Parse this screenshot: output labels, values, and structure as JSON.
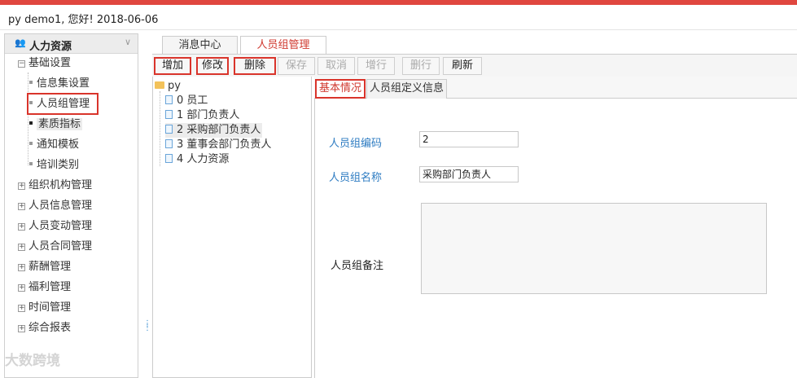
{
  "header": {
    "greeting": "py demo1, 您好! 2018-06-06"
  },
  "leftnav": {
    "title": "人力资源",
    "items": [
      {
        "label": "基础设置",
        "expanded": true
      },
      {
        "label": "信息集设置"
      },
      {
        "label": "人员组管理"
      },
      {
        "label": "素质指标"
      },
      {
        "label": "通知模板"
      },
      {
        "label": "培训类别"
      },
      {
        "label": "组织机构管理"
      },
      {
        "label": "人员信息管理"
      },
      {
        "label": "人员变动管理"
      },
      {
        "label": "人员合同管理"
      },
      {
        "label": "薪酬管理"
      },
      {
        "label": "福利管理"
      },
      {
        "label": "时间管理"
      },
      {
        "label": "综合报表"
      }
    ]
  },
  "tabs": [
    {
      "label": "消息中心"
    },
    {
      "label": "人员组管理"
    }
  ],
  "toolbar": {
    "add": "增加",
    "edit": "修改",
    "delete": "删除",
    "save": "保存",
    "cancel": "取消",
    "add_row": "增行",
    "delete_row": "删行",
    "refresh": "刷新"
  },
  "tree": {
    "root": "py",
    "children": [
      "0 员工",
      "1 部门负责人",
      "2 采购部门负责人",
      "3 董事会部门负责人",
      "4 人力资源"
    ]
  },
  "subtabs": [
    {
      "label": "基本情况"
    },
    {
      "label": "人员组定义信息"
    }
  ],
  "form": {
    "code_label": "人员组编码",
    "code_value": "2",
    "name_label": "人员组名称",
    "name_value": "采购部门负责人",
    "remark_label": "人员组备注"
  },
  "watermark": "大数跨境",
  "colors": {
    "accent": "#e0473f",
    "highlight": "#d9342b",
    "label_blue": "#2e7cc2"
  }
}
